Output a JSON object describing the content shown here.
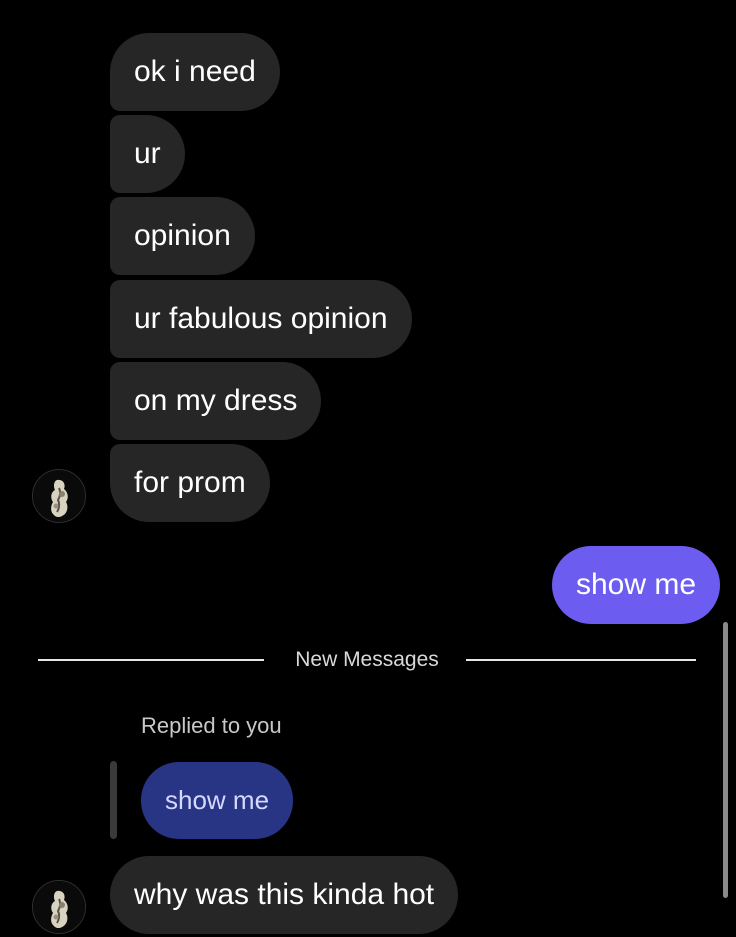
{
  "conversation": {
    "incoming_group": [
      {
        "text": "ok i need"
      },
      {
        "text": "ur"
      },
      {
        "text": "opinion"
      },
      {
        "text": "ur fabulous opinion"
      },
      {
        "text": "on my dress"
      },
      {
        "text": "for prom"
      }
    ],
    "outgoing": {
      "text": "show me"
    },
    "divider": {
      "label": "New Messages"
    },
    "reply": {
      "context_label": "Replied to you",
      "quoted_text": "show me",
      "message_text": "why was this kinda hot"
    }
  },
  "colors": {
    "background": "#000000",
    "incoming_bubble": "#262626",
    "outgoing_bubble": "#6d5cf0",
    "quoted_bubble": "#283484"
  },
  "icons": {
    "sender_avatar": "avatar-icon"
  }
}
